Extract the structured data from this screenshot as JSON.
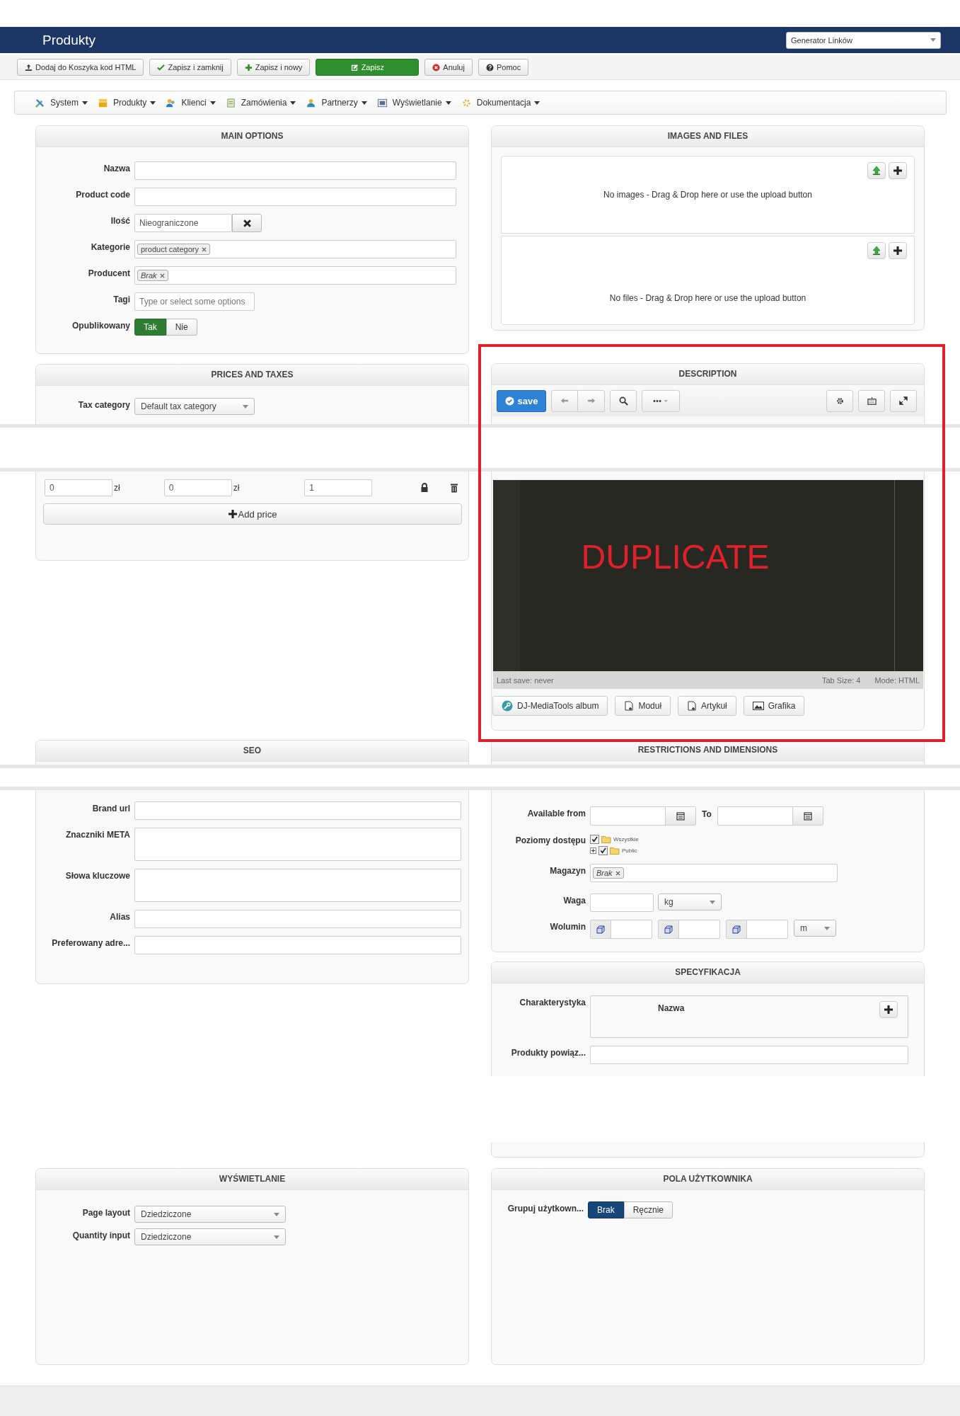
{
  "header": {
    "title": "Produkty",
    "link_select": "Generator Linków"
  },
  "toolbar": [
    {
      "label": "Dodaj do Koszyka kod HTML",
      "kind": "upload"
    },
    {
      "label": "Zapisz i zamknij",
      "kind": "check"
    },
    {
      "label": "Zapisz i nowy",
      "kind": "plus"
    },
    {
      "label": "Zapisz",
      "kind": "save"
    },
    {
      "label": "Anuluj",
      "kind": "cancel"
    },
    {
      "label": "Pomoc",
      "kind": "help"
    }
  ],
  "menu": [
    {
      "label": "System",
      "kind": "tools"
    },
    {
      "label": "Produkty",
      "kind": "box"
    },
    {
      "label": "Klienci",
      "kind": "users"
    },
    {
      "label": "Zamówienia",
      "kind": "orders"
    },
    {
      "label": "Partnerzy",
      "kind": "partners"
    },
    {
      "label": "Wyświetlanie",
      "kind": "display"
    },
    {
      "label": "Dokumentacja",
      "kind": "docs"
    }
  ],
  "main_options": {
    "title": "MAIN OPTIONS",
    "fields": [
      {
        "label": "Nazwa",
        "kind": "text"
      },
      {
        "label": "Product code",
        "kind": "text"
      },
      {
        "label": "Ilość",
        "kind": "clearable",
        "value": "Nieograniczone"
      },
      {
        "label": "Kategorie",
        "kind": "tags",
        "tag": "product category"
      },
      {
        "label": "Producent",
        "kind": "tags",
        "tag": "Brak"
      },
      {
        "label": "Tagi",
        "kind": "placeholder",
        "placeholder": "Type or select some options"
      },
      {
        "label": "Opublikowany",
        "kind": "toggle",
        "options": [
          {
            "label": "Tak",
            "selected": true
          },
          {
            "label": "Nie",
            "selected": false
          }
        ]
      }
    ]
  },
  "prices": {
    "title": "PRICES AND TAXES",
    "tax": {
      "label": "Tax category",
      "value": "Default tax category"
    },
    "row": {
      "net": "0",
      "net_unit": "zł",
      "gross": "0",
      "gross_unit": "zł",
      "quantity": "1"
    },
    "add_button": "Add price"
  },
  "images": {
    "title": "IMAGES AND FILES",
    "zones": [
      {
        "text": "No images - Drag & Drop here or use the upload button"
      },
      {
        "text": "No files - Drag & Drop here or use the upload button"
      }
    ]
  },
  "description": {
    "title": "DESCRIPTION",
    "save_label": "save",
    "overlay_text": "DUPLICATE",
    "status": {
      "last_save": "Last save: never",
      "tab_size": "Tab Size: 4",
      "mode": "Mode: HTML"
    },
    "buttons": [
      {
        "label": "DJ-MediaTools album",
        "kind": "media"
      },
      {
        "label": "Moduł",
        "kind": "doc"
      },
      {
        "label": "Artykuł",
        "kind": "doc"
      },
      {
        "label": "Grafika",
        "kind": "image"
      }
    ]
  },
  "seo": {
    "title": "SEO",
    "fields": [
      {
        "label": "Brand url",
        "kind": "text"
      },
      {
        "label": "Znaczniki META",
        "kind": "textarea"
      },
      {
        "label": "Słowa kluczowe",
        "kind": "textarea"
      },
      {
        "label": "Alias",
        "kind": "text"
      },
      {
        "label": "Preferowany adre...",
        "kind": "text"
      }
    ]
  },
  "restrictions": {
    "title": "RESTRICTIONS AND DIMENSIONS",
    "available": {
      "label": "Available from",
      "to": "To"
    },
    "access": {
      "label": "Poziomy dostępu",
      "items": [
        {
          "label": "Wszystkie",
          "checked": true,
          "children": [
            {
              "label": "Public",
              "checked": true,
              "expanded": false
            }
          ]
        }
      ]
    },
    "warehouse": {
      "label": "Magazyn",
      "tag": "Brak"
    },
    "weight": {
      "label": "Waga",
      "unit": "kg"
    },
    "volume": {
      "label": "Wolumin",
      "unit": "m"
    }
  },
  "spec": {
    "title": "SPECYFIKACJA",
    "features": {
      "label": "Charakterystyka",
      "column": "Nazwa"
    },
    "related": {
      "label": "Produkty powiąz..."
    }
  },
  "display": {
    "title": "WYŚWIETLANIE",
    "fields": [
      {
        "label": "Page layout",
        "value": "Dziedziczone"
      },
      {
        "label": "Quantity input",
        "value": "Dziedziczone"
      }
    ]
  },
  "user_fields": {
    "title": "POLA UŻYTKOWNIKA",
    "label": "Grupuj użytkown...",
    "options": [
      {
        "label": "Brak",
        "selected": true
      },
      {
        "label": "Ręcznie",
        "selected": false
      }
    ]
  }
}
